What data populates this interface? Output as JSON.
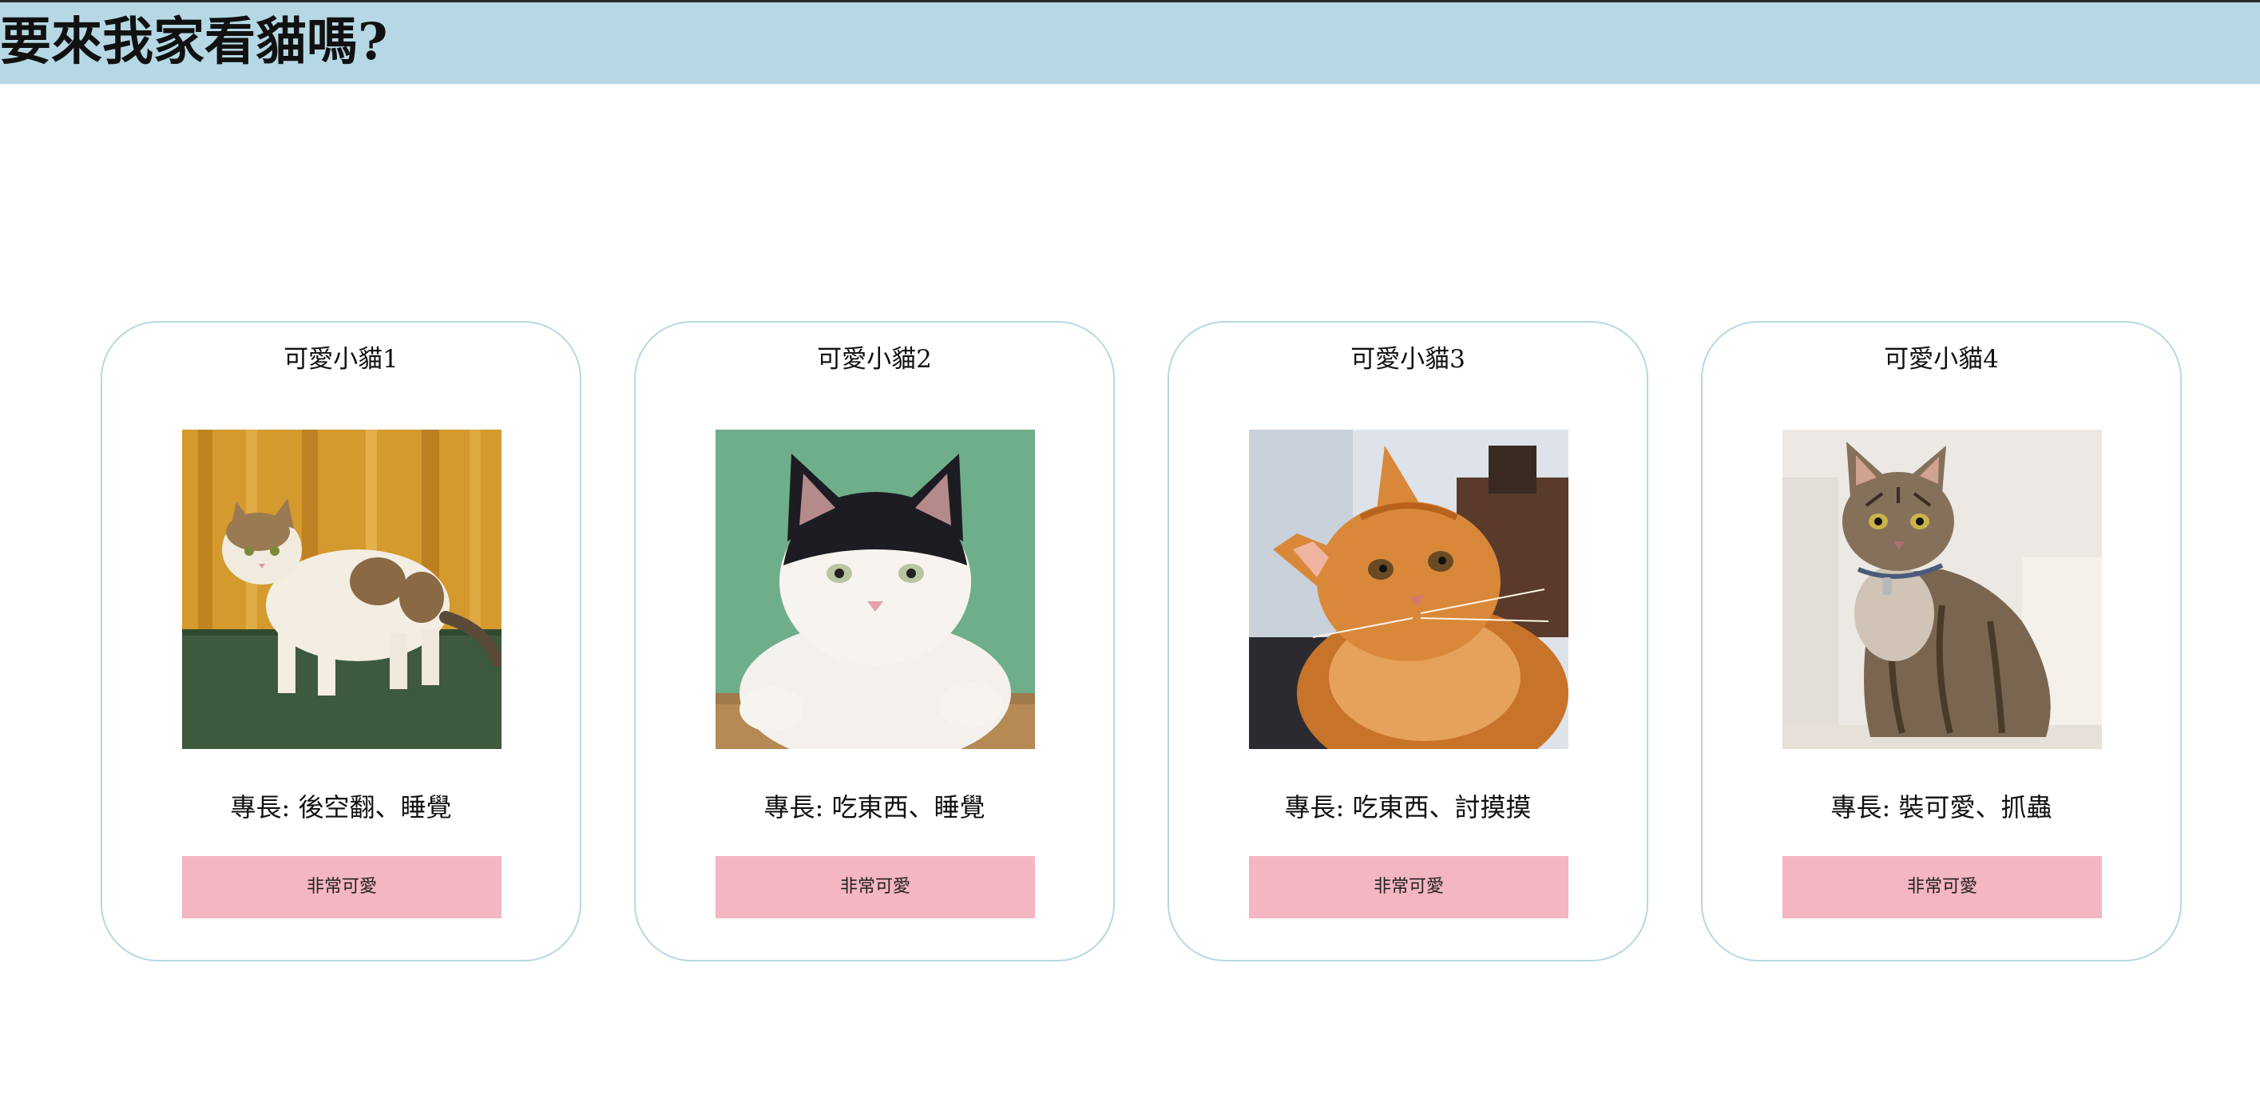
{
  "header": {
    "title": "要來我家看貓嗎?",
    "background_color": "#b5d8e4"
  },
  "cards": [
    {
      "title": "可愛小貓1",
      "photo_icon": "calico-cat-photo",
      "skill": "專長: 後空翻、睡覺",
      "button_label": "非常可愛"
    },
    {
      "title": "可愛小貓2",
      "photo_icon": "tuxedo-cat-photo",
      "skill": "專長: 吃東西、睡覺",
      "button_label": "非常可愛"
    },
    {
      "title": "可愛小貓3",
      "photo_icon": "orange-cat-photo",
      "skill": "專長: 吃東西、討摸摸",
      "button_label": "非常可愛"
    },
    {
      "title": "可愛小貓4",
      "photo_icon": "tabby-cat-photo",
      "skill": "專長: 裝可愛、抓蟲",
      "button_label": "非常可愛"
    }
  ],
  "colors": {
    "card_border": "#b5d8e4",
    "button_background": "#f4b6c2"
  }
}
